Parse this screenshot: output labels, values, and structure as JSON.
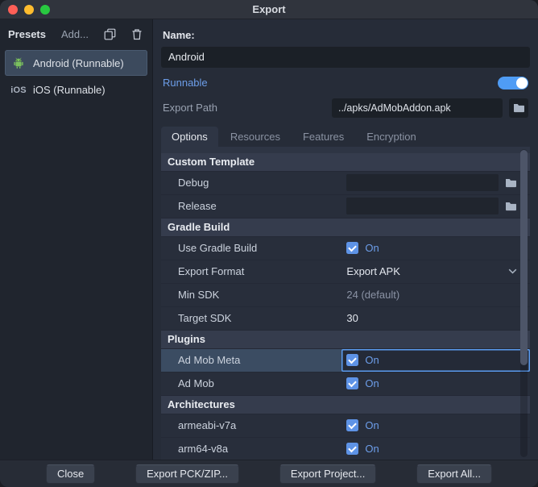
{
  "window": {
    "title": "Export"
  },
  "sidebar": {
    "title": "Presets",
    "add_label": "Add...",
    "items": [
      {
        "label": "Android (Runnable)",
        "icon": "android",
        "selected": true
      },
      {
        "label": "iOS (Runnable)",
        "icon": "ios",
        "selected": false
      }
    ]
  },
  "form": {
    "name_label": "Name:",
    "name_value": "Android",
    "runnable_label": "Runnable",
    "runnable_on": true,
    "export_path_label": "Export Path",
    "export_path_value": "../apks/AdMobAddon.apk"
  },
  "tabs": [
    {
      "label": "Options",
      "active": true
    },
    {
      "label": "Resources",
      "active": false
    },
    {
      "label": "Features",
      "active": false
    },
    {
      "label": "Encryption",
      "active": false
    }
  ],
  "options_tree": {
    "sections": [
      {
        "header": "Custom Template",
        "rows": [
          {
            "label": "Debug",
            "type": "path",
            "value": ""
          },
          {
            "label": "Release",
            "type": "path",
            "value": ""
          }
        ]
      },
      {
        "header": "Gradle Build",
        "rows": [
          {
            "label": "Use Gradle Build",
            "type": "checkbox",
            "checked": true,
            "value": "On"
          },
          {
            "label": "Export Format",
            "type": "dropdown",
            "value": "Export APK"
          },
          {
            "label": "Min SDK",
            "type": "text",
            "value": "24 (default)",
            "dim": true
          },
          {
            "label": "Target SDK",
            "type": "text",
            "value": "30",
            "dim": false
          }
        ]
      },
      {
        "header": "Plugins",
        "rows": [
          {
            "label": "Ad Mob Meta",
            "type": "checkbox",
            "checked": true,
            "value": "On",
            "selected": true
          },
          {
            "label": "Ad Mob",
            "type": "checkbox",
            "checked": true,
            "value": "On"
          }
        ]
      },
      {
        "header": "Architectures",
        "rows": [
          {
            "label": "armeabi-v7a",
            "type": "checkbox",
            "checked": true,
            "value": "On"
          },
          {
            "label": "arm64-v8a",
            "type": "checkbox",
            "checked": true,
            "value": "On"
          }
        ]
      }
    ]
  },
  "footer": {
    "buttons": [
      "Close",
      "Export PCK/ZIP...",
      "Export Project...",
      "Export All..."
    ]
  },
  "colors": {
    "accent": "#6d9eea",
    "toggle_on": "#4f9cf5",
    "checkbox": "#5e93e6",
    "selection_border": "#5b9cf0",
    "android_green": "#7bc15e"
  }
}
